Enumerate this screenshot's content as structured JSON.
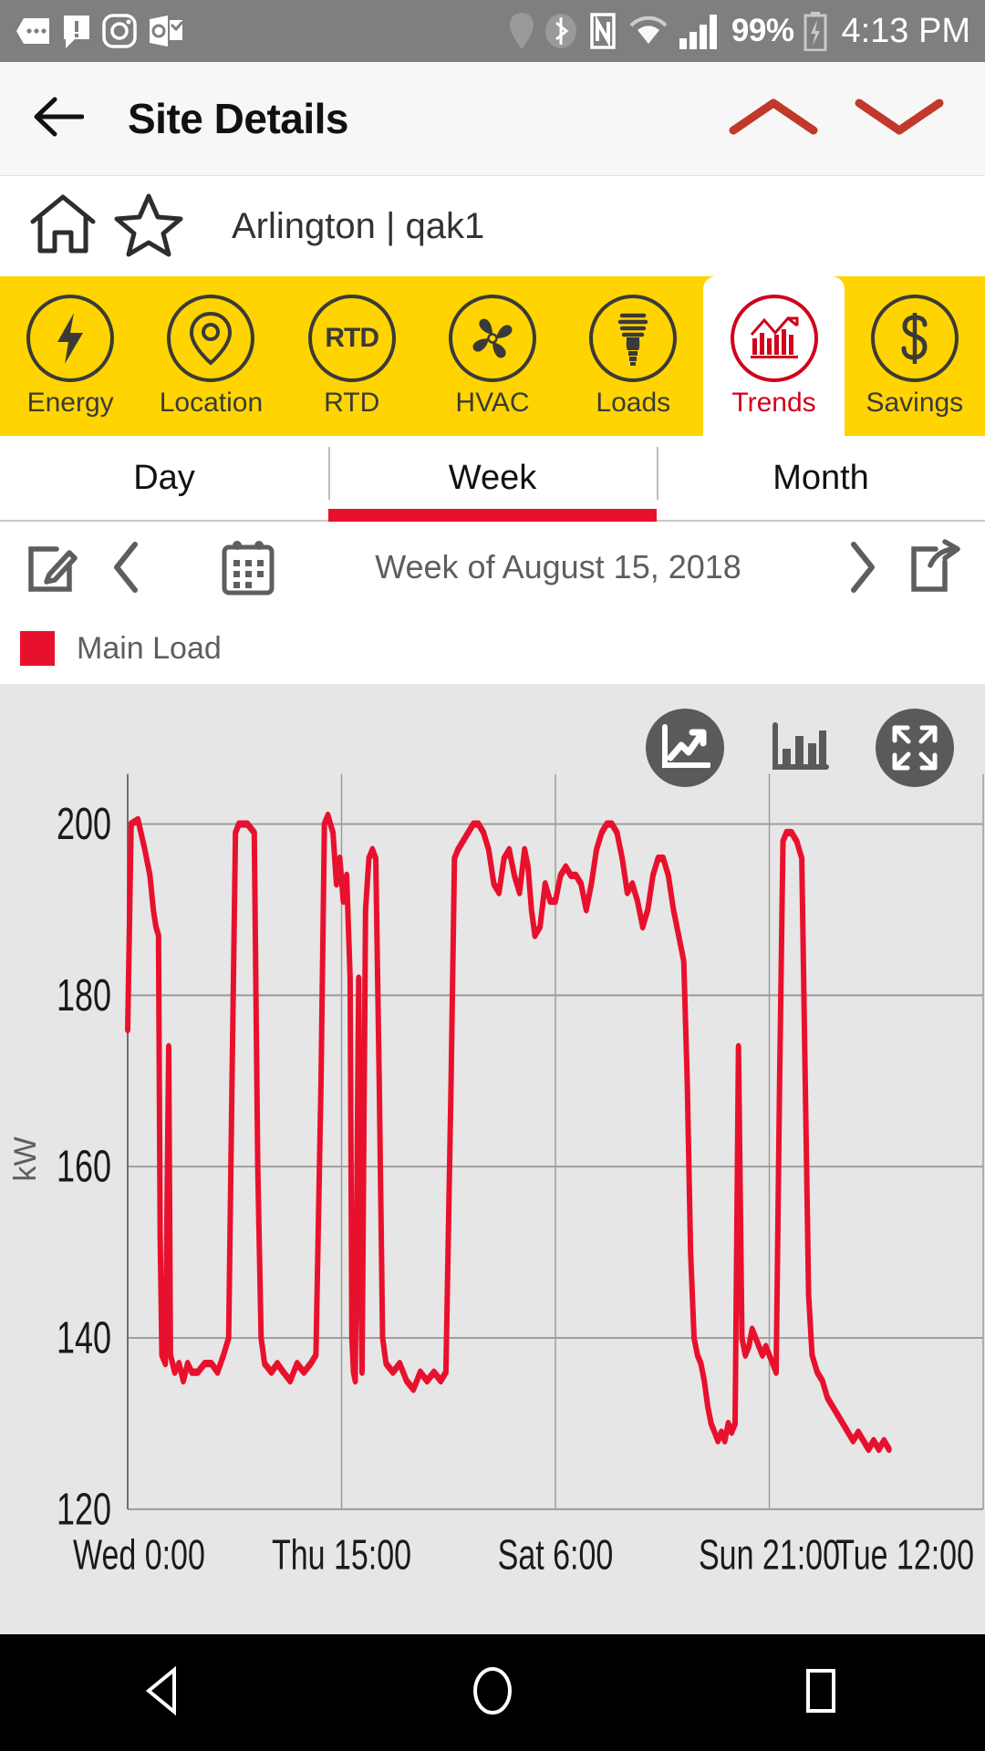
{
  "status_bar": {
    "icons": [
      "messaging-icon",
      "alert-icon",
      "instagram-icon",
      "outlook-icon",
      "location-icon",
      "bluetooth-icon",
      "nfc-icon",
      "wifi-icon",
      "cellular-signal-icon"
    ],
    "battery_percent": "99%",
    "battery_icon": "battery-charging-icon",
    "time": "4:13 PM"
  },
  "app_bar": {
    "back_icon": "back-arrow-icon",
    "title": "Site Details",
    "collapse_icon": "chevron-up-icon",
    "expand_icon": "chevron-down-icon"
  },
  "site": {
    "home_icon": "home-icon",
    "favorite_icon": "star-icon",
    "name": "Arlington | qak1"
  },
  "category_tabs": {
    "selected": "Trends",
    "accent_color": "#FFD400",
    "selected_color": "#D0021B",
    "items": [
      {
        "label": "Energy",
        "icon": "bolt-icon"
      },
      {
        "label": "Location",
        "icon": "map-pin-icon"
      },
      {
        "label": "RTD",
        "icon": "rtd-icon"
      },
      {
        "label": "HVAC",
        "icon": "fan-icon"
      },
      {
        "label": "Loads",
        "icon": "lightbulb-icon"
      },
      {
        "label": "Trends",
        "icon": "bar-chart-icon"
      },
      {
        "label": "Savings",
        "icon": "dollar-icon"
      }
    ]
  },
  "period_tabs": {
    "selected": "Week",
    "indicator_color": "#E8112D",
    "items": [
      {
        "label": "Day"
      },
      {
        "label": "Week"
      },
      {
        "label": "Month"
      }
    ]
  },
  "date_nav": {
    "edit_icon": "edit-icon",
    "prev_icon": "chevron-left-icon",
    "calendar_icon": "calendar-icon",
    "label": "Week of August 15, 2018",
    "next_icon": "chevron-right-icon",
    "share_icon": "share-icon"
  },
  "legend": {
    "series_label": "Main Load",
    "series_color": "#E8112D"
  },
  "chart_toolbar": {
    "line_chart_icon": "line-chart-icon",
    "bar_chart_icon": "bar-chart-icon",
    "fullscreen_icon": "fullscreen-icon",
    "active": "line-chart-icon"
  },
  "nav_bar": {
    "back_icon": "nav-back-triangle-icon",
    "home_icon": "nav-home-circle-icon",
    "recents_icon": "nav-recents-square-icon"
  },
  "chart_data": {
    "type": "line",
    "title": "",
    "xlabel": "",
    "ylabel": "kW",
    "ylim": [
      120,
      200
    ],
    "yticks": [
      120,
      140,
      160,
      180,
      200
    ],
    "grid": true,
    "legend_position": "above-left",
    "xticks": [
      "Wed 0:00",
      "Thu 15:00",
      "Sat 6:00",
      "Sun 21:00",
      "Tue 12:00"
    ],
    "xtick_positions": [
      0,
      0.25,
      0.5,
      0.75,
      1.0
    ],
    "series": [
      {
        "name": "Main Load",
        "color": "#E8112D",
        "points": [
          [
            0.0,
            176
          ],
          [
            0.004,
            200
          ],
          [
            0.012,
            200.5
          ],
          [
            0.02,
            197
          ],
          [
            0.026,
            194
          ],
          [
            0.03,
            190
          ],
          [
            0.033,
            188
          ],
          [
            0.036,
            187
          ],
          [
            0.038,
            152
          ],
          [
            0.04,
            138
          ],
          [
            0.044,
            137
          ],
          [
            0.048,
            174
          ],
          [
            0.05,
            138
          ],
          [
            0.055,
            136
          ],
          [
            0.06,
            137
          ],
          [
            0.065,
            135
          ],
          [
            0.07,
            137
          ],
          [
            0.075,
            136
          ],
          [
            0.082,
            136
          ],
          [
            0.09,
            137
          ],
          [
            0.098,
            137
          ],
          [
            0.105,
            136
          ],
          [
            0.112,
            138
          ],
          [
            0.118,
            140
          ],
          [
            0.122,
            170
          ],
          [
            0.126,
            199
          ],
          [
            0.13,
            200
          ],
          [
            0.14,
            200
          ],
          [
            0.148,
            199
          ],
          [
            0.152,
            160
          ],
          [
            0.156,
            140
          ],
          [
            0.16,
            137
          ],
          [
            0.168,
            136
          ],
          [
            0.175,
            137
          ],
          [
            0.182,
            136
          ],
          [
            0.19,
            135
          ],
          [
            0.198,
            137
          ],
          [
            0.206,
            136
          ],
          [
            0.214,
            137
          ],
          [
            0.22,
            138
          ],
          [
            0.226,
            170
          ],
          [
            0.23,
            200
          ],
          [
            0.234,
            201
          ],
          [
            0.24,
            199
          ],
          [
            0.244,
            193
          ],
          [
            0.248,
            196
          ],
          [
            0.252,
            191
          ],
          [
            0.256,
            194
          ],
          [
            0.26,
            182
          ],
          [
            0.262,
            140
          ],
          [
            0.264,
            136
          ],
          [
            0.266,
            135
          ],
          [
            0.27,
            182
          ],
          [
            0.272,
            150
          ],
          [
            0.274,
            136
          ],
          [
            0.278,
            190
          ],
          [
            0.282,
            196
          ],
          [
            0.286,
            197
          ],
          [
            0.29,
            196
          ],
          [
            0.294,
            170
          ],
          [
            0.298,
            140
          ],
          [
            0.302,
            137
          ],
          [
            0.31,
            136
          ],
          [
            0.318,
            137
          ],
          [
            0.326,
            135
          ],
          [
            0.334,
            134
          ],
          [
            0.342,
            136
          ],
          [
            0.35,
            135
          ],
          [
            0.358,
            136
          ],
          [
            0.366,
            135
          ],
          [
            0.372,
            136
          ],
          [
            0.378,
            170
          ],
          [
            0.382,
            196
          ],
          [
            0.386,
            197
          ],
          [
            0.392,
            198
          ],
          [
            0.398,
            199
          ],
          [
            0.404,
            200
          ],
          [
            0.41,
            200
          ],
          [
            0.416,
            199
          ],
          [
            0.422,
            197
          ],
          [
            0.428,
            193
          ],
          [
            0.434,
            192
          ],
          [
            0.44,
            196
          ],
          [
            0.446,
            197
          ],
          [
            0.452,
            194
          ],
          [
            0.458,
            192
          ],
          [
            0.464,
            197
          ],
          [
            0.468,
            195
          ],
          [
            0.472,
            190
          ],
          [
            0.476,
            187
          ],
          [
            0.482,
            188
          ],
          [
            0.488,
            193
          ],
          [
            0.494,
            191
          ],
          [
            0.5,
            191
          ],
          [
            0.506,
            194
          ],
          [
            0.512,
            195
          ],
          [
            0.518,
            194
          ],
          [
            0.524,
            194
          ],
          [
            0.53,
            193
          ],
          [
            0.536,
            190
          ],
          [
            0.542,
            193
          ],
          [
            0.548,
            197
          ],
          [
            0.554,
            199
          ],
          [
            0.56,
            200
          ],
          [
            0.566,
            200
          ],
          [
            0.572,
            199
          ],
          [
            0.578,
            196
          ],
          [
            0.584,
            192
          ],
          [
            0.59,
            193
          ],
          [
            0.596,
            191
          ],
          [
            0.602,
            188
          ],
          [
            0.608,
            190
          ],
          [
            0.614,
            194
          ],
          [
            0.62,
            196
          ],
          [
            0.626,
            196
          ],
          [
            0.632,
            194
          ],
          [
            0.638,
            190
          ],
          [
            0.644,
            187
          ],
          [
            0.65,
            184
          ],
          [
            0.654,
            170
          ],
          [
            0.658,
            150
          ],
          [
            0.662,
            140
          ],
          [
            0.666,
            138
          ],
          [
            0.67,
            137
          ],
          [
            0.674,
            135
          ],
          [
            0.678,
            132
          ],
          [
            0.682,
            130
          ],
          [
            0.686,
            129
          ],
          [
            0.69,
            128
          ],
          [
            0.694,
            129
          ],
          [
            0.698,
            128
          ],
          [
            0.702,
            130
          ],
          [
            0.706,
            129
          ],
          [
            0.71,
            130
          ],
          [
            0.714,
            174
          ],
          [
            0.718,
            140
          ],
          [
            0.722,
            138
          ],
          [
            0.726,
            139
          ],
          [
            0.73,
            141
          ],
          [
            0.734,
            140
          ],
          [
            0.738,
            139
          ],
          [
            0.742,
            138
          ],
          [
            0.746,
            139
          ],
          [
            0.75,
            138
          ],
          [
            0.754,
            137
          ],
          [
            0.758,
            136
          ],
          [
            0.762,
            170
          ],
          [
            0.766,
            198
          ],
          [
            0.77,
            199
          ],
          [
            0.776,
            199
          ],
          [
            0.782,
            198
          ],
          [
            0.788,
            196
          ],
          [
            0.792,
            170
          ],
          [
            0.796,
            145
          ],
          [
            0.8,
            138
          ],
          [
            0.806,
            136
          ],
          [
            0.812,
            135
          ],
          [
            0.818,
            133
          ],
          [
            0.824,
            132
          ],
          [
            0.83,
            131
          ],
          [
            0.836,
            130
          ],
          [
            0.842,
            129
          ],
          [
            0.848,
            128
          ],
          [
            0.854,
            129
          ],
          [
            0.86,
            128
          ],
          [
            0.866,
            127
          ],
          [
            0.872,
            128
          ],
          [
            0.878,
            127
          ],
          [
            0.884,
            128
          ],
          [
            0.89,
            127
          ]
        ]
      }
    ]
  }
}
